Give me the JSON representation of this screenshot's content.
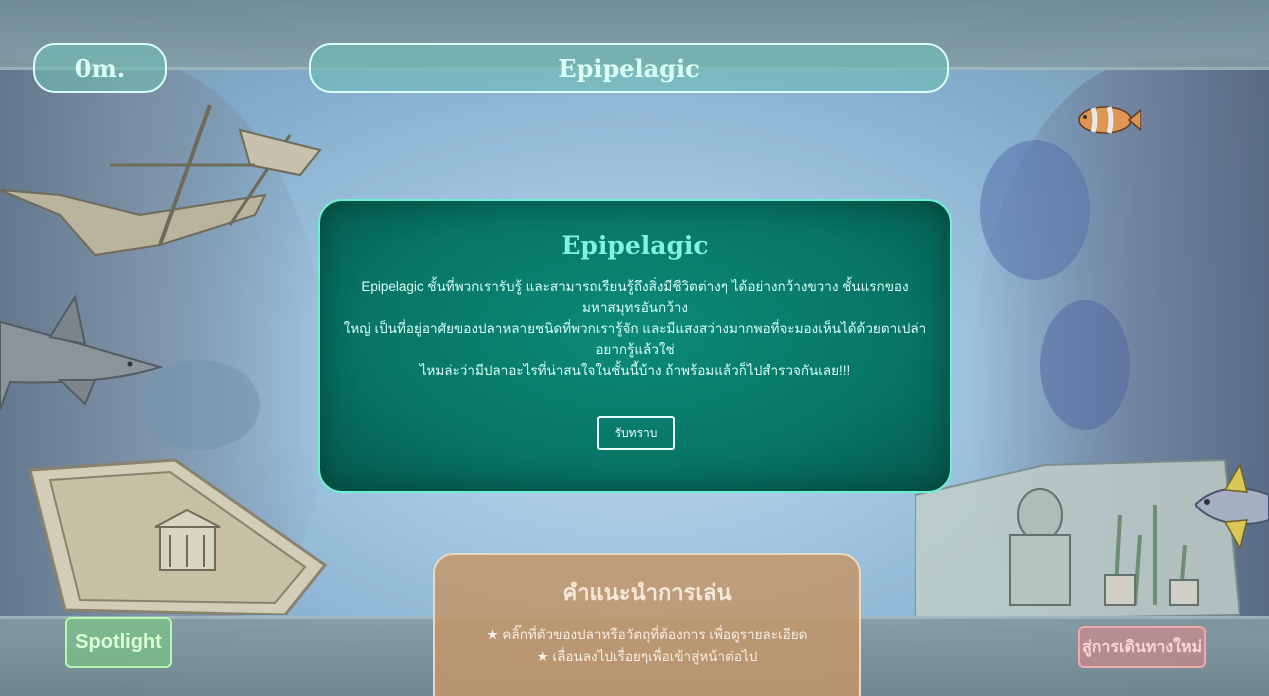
{
  "hud": {
    "depth": "0m.",
    "zone_name": "Epipelagic"
  },
  "modal": {
    "title": "Epipelagic",
    "body_lines": [
      "Epipelagic ชั้นที่พวกเรารับรู้ และสามารถเรียนรู้ถึงสิ่งมีชีวิตต่างๆ ได้อย่างกว้างขวาง ชั้นแรกของมหาสมุทรอันกว้าง",
      "ใหญ่ เป็นที่อยู่อาศัยของปลาหลายชนิดที่พวกเรารู้จัก และมีแสงสว่างมากพอที่จะมองเห็นได้ด้วยตาเปล่า อยากรู้แล้วใช่",
      "ไหมล่ะว่ามีปลาอะไรที่น่าสนใจในชั้นนี้บ้าง ถ้าพร้อมแล้วก็ไปสำรวจกันเลย!!!"
    ],
    "ack_label": "รับทราบ"
  },
  "guide": {
    "title": "คำแนะนำการเล่น",
    "tips": [
      "★ คลิ๊กที่ตัวของปลาหรือวัตถุที่ต้องการ เพื่อดูรายละเอียด",
      "★ เลื่อนลงไปเรื่อยๆเพื่อเข้าสู่หน้าต่อไป"
    ]
  },
  "buttons": {
    "spotlight": "Spotlight",
    "new_path": "สู่การเดินทางใหม่"
  },
  "colors": {
    "hud_border": "#d9fff6",
    "modal_bg": "#087565",
    "modal_border": "#6ff0d4",
    "modal_title": "#7ff5df",
    "guide_bg": "#c4966a",
    "spotlight": "#b5f7b0",
    "new_path": "#f2a9a9"
  },
  "scene_objects": [
    "shipwreck",
    "shark",
    "sunken-ruins",
    "clownfish",
    "statue-garden",
    "tuna"
  ]
}
